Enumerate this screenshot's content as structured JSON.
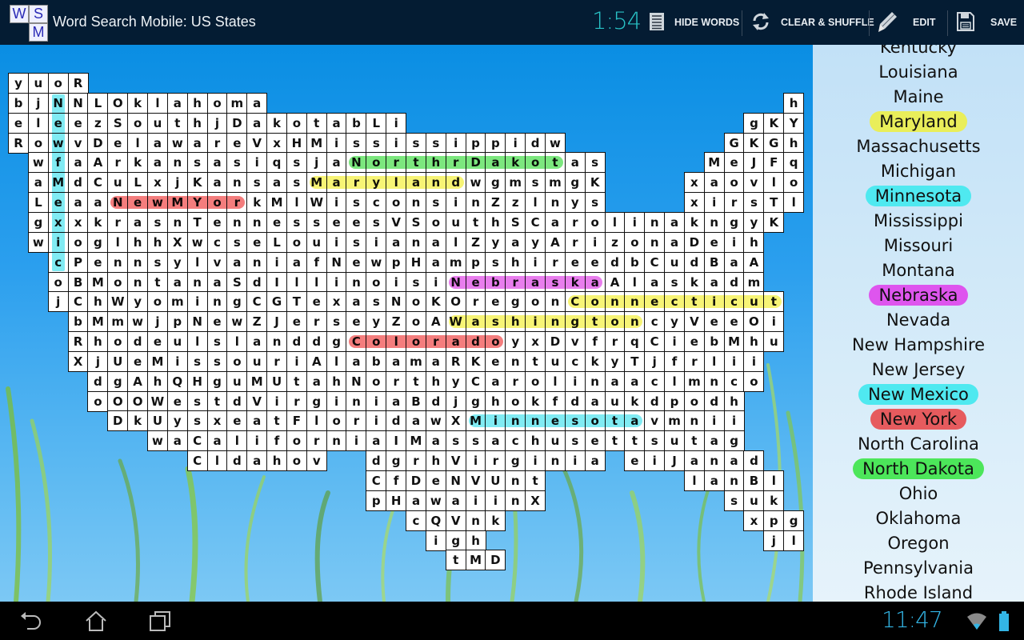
{
  "app": {
    "logo_letters": [
      "W",
      "S",
      "M"
    ],
    "title": "Word Search Mobile: US States",
    "timer": "1:54"
  },
  "actions": [
    {
      "label": "HIDE WORDS",
      "icon": "list-icon"
    },
    {
      "label": "CLEAR & SHUFFLE",
      "icon": "refresh-icon"
    },
    {
      "label": "EDIT",
      "icon": "pencil-icon"
    },
    {
      "label": "SAVE",
      "icon": "floppy-disk-icon"
    }
  ],
  "grid": {
    "rows": [
      [
        {
          "col": 0,
          "letters": "yuoR"
        }
      ],
      [
        {
          "col": 0,
          "letters": "bjNNLOklahoma"
        },
        {
          "col": 39,
          "letters": "h"
        }
      ],
      [
        {
          "col": 0,
          "letters": "eleezSouthjDakotabLi"
        },
        {
          "col": 37,
          "letters": "gKY"
        }
      ],
      [
        {
          "col": 0,
          "letters": "RowvDelawareVxHMississippidw"
        },
        {
          "col": 36,
          "letters": "GKGh"
        }
      ],
      [
        {
          "col": 1,
          "letters": "wfaArkansasiqsjaNorthrDakotas"
        },
        {
          "col": 35,
          "letters": "MeJFq"
        }
      ],
      [
        {
          "col": 1,
          "letters": "aMdCuLxjKansasMarylandwgmsmgK"
        },
        {
          "col": 34,
          "letters": "xaovlo"
        }
      ],
      [
        {
          "col": 1,
          "letters": "LeaaNewMYorkMlWisconsinZzlnys"
        },
        {
          "col": 34,
          "letters": "xirsTl"
        }
      ],
      [
        {
          "col": 1,
          "letters": "gxxkrasnTennesseesVSouthSCarolinakngyK"
        }
      ],
      [
        {
          "col": 1,
          "letters": "wioglhhXwcseLouisianalZyayArizonaDeih"
        }
      ],
      [
        {
          "col": 2,
          "letters": "cPennsylvaniafNewpHampshireedbCudBaA"
        }
      ],
      [
        {
          "col": 2,
          "letters": "oBMontanaSdIllinoisiNebraskaAlaskadm"
        }
      ],
      [
        {
          "col": 2,
          "letters": "jChWyomingCGTexasNoKOregonConnecticut"
        }
      ],
      [
        {
          "col": 3,
          "letters": "bMmwjpNewZJerseyZoAWashingtoncyVeeOi"
        }
      ],
      [
        {
          "col": 3,
          "letters": "RhodeulslanddgColoradoyxDvfrqCiebMhu"
        }
      ],
      [
        {
          "col": 3,
          "letters": "XjUeMissouriAlabamaRKentuckyTjfrlii"
        }
      ],
      [
        {
          "col": 4,
          "letters": "dgAhQHguMUtahNorthyCarolinaaclmnco"
        }
      ],
      [
        {
          "col": 4,
          "letters": "oOOWestdVirginiaBdjghokfdaukdpodh"
        }
      ],
      [
        {
          "col": 5,
          "letters": "DkUysxeatFloridawXMinnesotavmnii"
        }
      ],
      [
        {
          "col": 7,
          "letters": "waCaliforniaIMassachusettsutag"
        }
      ],
      [
        {
          "col": 9,
          "letters": "Cldahov"
        },
        {
          "col": 18,
          "letters": "dgrhVirginia"
        },
        {
          "col": 31,
          "letters": "eiJanad"
        }
      ],
      [
        {
          "col": 18,
          "letters": "CfDeNVUnt"
        },
        {
          "col": 34,
          "letters": "lanBl"
        }
      ],
      [
        {
          "col": 18,
          "letters": "pHawaiinX"
        },
        {
          "col": 36,
          "letters": "suk"
        }
      ],
      [
        {
          "col": 20,
          "letters": "cQVnk"
        },
        {
          "col": 37,
          "letters": "xpg"
        }
      ],
      [
        {
          "col": 21,
          "letters": "igh"
        },
        {
          "col": 38,
          "letters": "jl"
        }
      ],
      [
        {
          "col": 22,
          "letters": "tMD"
        }
      ]
    ],
    "found_words": [
      {
        "word": "New Mexico",
        "direction": "vertical",
        "row": 1,
        "col": 2,
        "length": 9,
        "color": "#4fe3ee"
      },
      {
        "word": "North Dakota",
        "direction": "horizontal",
        "row": 4,
        "col": 17,
        "length": 11,
        "color": "#49de4c"
      },
      {
        "word": "Maryland",
        "direction": "horizontal",
        "row": 5,
        "col": 15,
        "length": 8,
        "color": "#f4f040"
      },
      {
        "word": "New York",
        "direction": "horizontal",
        "row": 6,
        "col": 5,
        "length": 7,
        "color": "#f04a4a"
      },
      {
        "word": "Nebraska",
        "direction": "horizontal",
        "row": 10,
        "col": 22,
        "length": 8,
        "color": "#e04ae6"
      },
      {
        "word": "Connecticut",
        "direction": "horizontal",
        "row": 11,
        "col": 28,
        "length": 11,
        "color": "#f4f040"
      },
      {
        "word": "Washington",
        "direction": "horizontal",
        "row": 12,
        "col": 22,
        "length": 10,
        "color": "#f4f040"
      },
      {
        "word": "Colorado",
        "direction": "horizontal",
        "row": 13,
        "col": 17,
        "length": 8,
        "color": "#f04a4a"
      },
      {
        "word": "Minnesota",
        "direction": "horizontal",
        "row": 17,
        "col": 23,
        "length": 9,
        "color": "#4fe3ee"
      }
    ]
  },
  "word_list": [
    {
      "word": "Kentucky",
      "found": false
    },
    {
      "word": "Louisiana",
      "found": false
    },
    {
      "word": "Maine",
      "found": false
    },
    {
      "word": "Maryland",
      "found": true,
      "color": "#e9ee5a"
    },
    {
      "word": "Massachusetts",
      "found": false
    },
    {
      "word": "Michigan",
      "found": false
    },
    {
      "word": "Minnesota",
      "found": true,
      "color": "#4fe9f0"
    },
    {
      "word": "Mississippi",
      "found": false
    },
    {
      "word": "Missouri",
      "found": false
    },
    {
      "word": "Montana",
      "found": false
    },
    {
      "word": "Nebraska",
      "found": true,
      "color": "#de55ee"
    },
    {
      "word": "Nevada",
      "found": false
    },
    {
      "word": "New Hampshire",
      "found": false
    },
    {
      "word": "New Jersey",
      "found": false
    },
    {
      "word": "New Mexico",
      "found": true,
      "color": "#4fe9f0"
    },
    {
      "word": "New York",
      "found": true,
      "color": "#e65b5e"
    },
    {
      "word": "North Carolina",
      "found": false
    },
    {
      "word": "North Dakota",
      "found": true,
      "color": "#4ce65a"
    },
    {
      "word": "Ohio",
      "found": false
    },
    {
      "word": "Oklahoma",
      "found": false
    },
    {
      "word": "Oregon",
      "found": false
    },
    {
      "word": "Pennsylvania",
      "found": false
    },
    {
      "word": "Rhode Island",
      "found": false
    }
  ],
  "system_bar": {
    "clock": "11:47",
    "nav_buttons": [
      "back-icon",
      "home-icon",
      "recent-apps-icon"
    ]
  }
}
